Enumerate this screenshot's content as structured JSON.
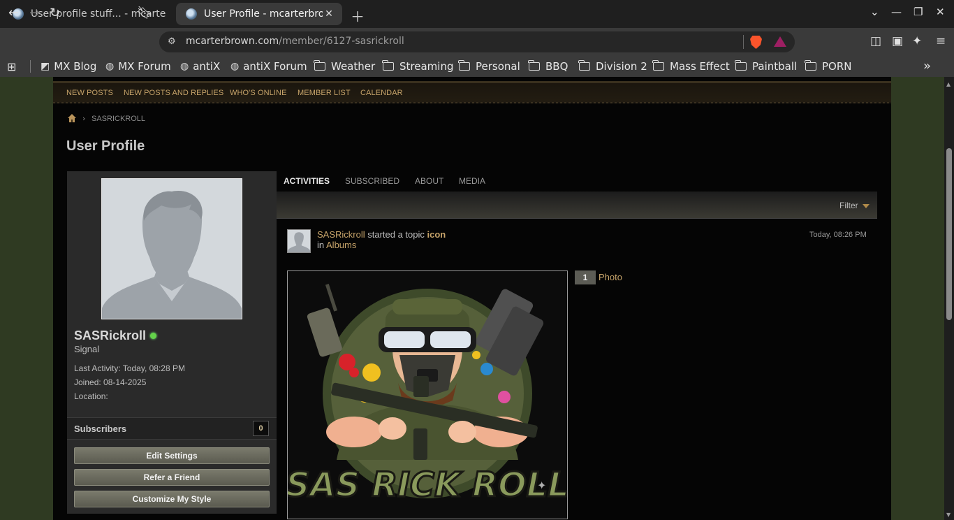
{
  "browser": {
    "tabs": [
      {
        "title": "User profile stuff... - mcarterb",
        "active": false
      },
      {
        "title": "User Profile - mcarterbrow",
        "active": true
      }
    ],
    "new_tab_icon": "plus-icon",
    "url_host": "mcarterbrown.com",
    "url_path": "/member/6127-sasrickroll",
    "bookmarks": [
      {
        "label": "MX Blog",
        "icon": "mx-icon"
      },
      {
        "label": "MX Forum",
        "icon": "globe-icon"
      },
      {
        "label": "antiX",
        "icon": "globe-icon"
      },
      {
        "label": "antiX Forum",
        "icon": "globe-icon"
      },
      {
        "label": "Weather",
        "icon": "folder-icon"
      },
      {
        "label": "Streaming",
        "icon": "folder-icon"
      },
      {
        "label": "Personal",
        "icon": "folder-icon"
      },
      {
        "label": "BBQ",
        "icon": "folder-icon"
      },
      {
        "label": "Division 2",
        "icon": "folder-icon"
      },
      {
        "label": "Mass Effect",
        "icon": "folder-icon"
      },
      {
        "label": "Paintball",
        "icon": "folder-icon"
      },
      {
        "label": "PORN",
        "icon": "folder-icon"
      }
    ]
  },
  "site": {
    "nav": [
      "NEW POSTS",
      "NEW POSTS AND REPLIES",
      "WHO'S ONLINE",
      "MEMBER LIST",
      "CALENDAR"
    ],
    "breadcrumb": "SASRICKROLL",
    "page_title": "User Profile"
  },
  "profile": {
    "username": "SASRickroll",
    "online": true,
    "user_title": "Signal",
    "last_activity": "Last Activity: Today, 08:28 PM",
    "joined": "Joined: 08-14-2025",
    "location": "Location:",
    "subscribers_label": "Subscribers",
    "subscribers_count": "0",
    "buttons": [
      "Edit Settings",
      "Refer a Friend",
      "Customize My Style"
    ]
  },
  "content": {
    "tabs": [
      "ACTIVITIES",
      "SUBSCRIBED",
      "ABOUT",
      "MEDIA"
    ],
    "active_tab": "ACTIVITIES",
    "filter_label": "Filter",
    "activity": {
      "user": "SASRickroll",
      "action": " started a topic ",
      "topic": "icon",
      "in_prefix": "in ",
      "forum": "Albums",
      "time": "Today, 08:26 PM",
      "photo_count": "1",
      "photo_label": "Photo",
      "image_text": "SAS RICK ROLL"
    }
  },
  "colors": {
    "accent_link": "#c7a46a",
    "online_dot": "#64d24a",
    "page_bg": "#050505",
    "outer_bg": "#2f3a22"
  }
}
